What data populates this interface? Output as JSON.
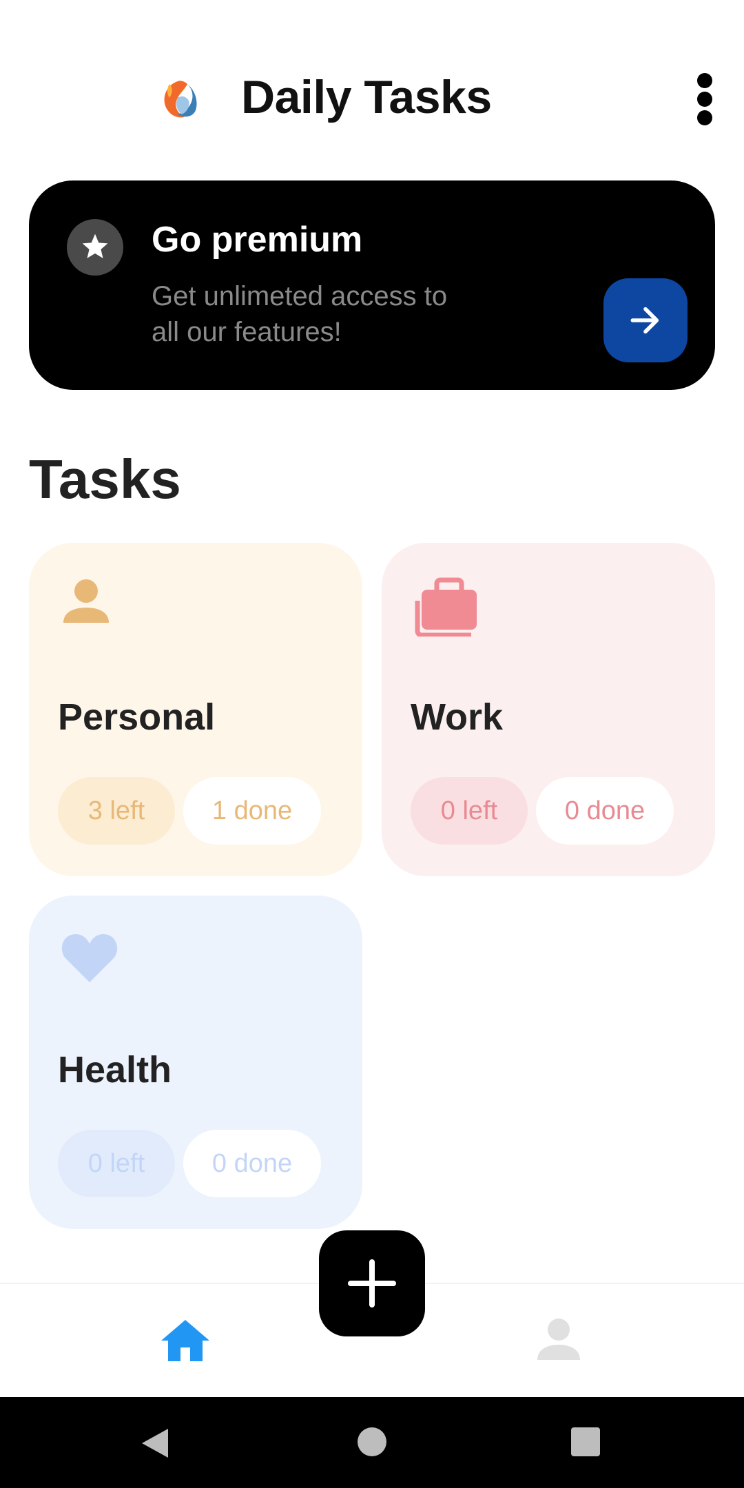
{
  "header": {
    "title": "Daily Tasks",
    "logo_icon": "app-logo-icon",
    "menu_icon": "more-vert-icon"
  },
  "premium": {
    "title": "Go premium",
    "description": "Get unlimeted access to all our features!",
    "icon": "star-icon",
    "action_icon": "arrow-right-icon",
    "accent_color": "#0d47a1"
  },
  "section": {
    "title": "Tasks"
  },
  "cards": [
    {
      "title": "Personal",
      "left": "3 left",
      "done": "1 done",
      "icon": "person-icon",
      "color": "#e8b877"
    },
    {
      "title": "Work",
      "left": "0 left",
      "done": "0 done",
      "icon": "briefcase-icon",
      "color": "#f08a93"
    },
    {
      "title": "Health",
      "left": "0 left",
      "done": "0 done",
      "icon": "heart-icon",
      "color": "#c3d5f7"
    }
  ],
  "bottom_nav": {
    "items": [
      {
        "icon": "home-icon",
        "active": true,
        "color": "#2196f3"
      },
      {
        "icon": "profile-icon",
        "active": false,
        "color": "#e0e0e0"
      }
    ],
    "fab_icon": "plus-icon"
  },
  "system_nav": {
    "icons": [
      "back-icon",
      "home-circle-icon",
      "recents-icon"
    ]
  }
}
